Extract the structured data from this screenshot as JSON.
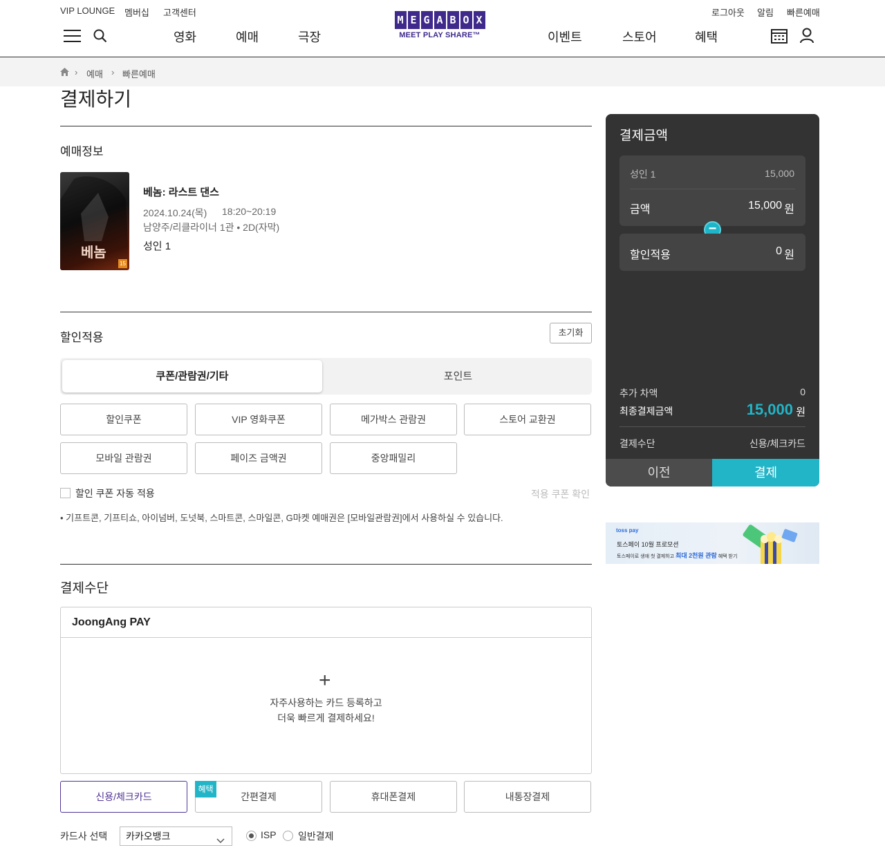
{
  "header": {
    "util_left": [
      "VIP LOUNGE",
      "멤버십",
      "고객센터"
    ],
    "util_right": [
      "로그아웃",
      "알림",
      "빠른예매"
    ],
    "nav_left": [
      "영화",
      "예매",
      "극장"
    ],
    "nav_right": [
      "이벤트",
      "스토어",
      "혜택"
    ],
    "logo_letters": [
      "M",
      "E",
      "G",
      "A",
      "B",
      "O",
      "X"
    ],
    "logo_tagline": "MEET PLAY SHARE™",
    "brand_color": "#3f2a8c"
  },
  "breadcrumb": [
    "예매",
    "빠른예매"
  ],
  "page_title": "결제하기",
  "booking": {
    "section_title": "예매정보",
    "movie_title": "베놈: 라스트 댄스",
    "datetime": "2024.10.24(목)",
    "time": "18:20~20:19",
    "theater": "남양주/리클라이너 1관 • 2D(자막)",
    "people": "성인 1",
    "poster_text": "베놈",
    "rating": "15"
  },
  "discount": {
    "section_title": "할인적용",
    "reset_label": "초기화",
    "tabs": [
      "쿠폰/관람권/기타",
      "포인트"
    ],
    "options": [
      "할인쿠폰",
      "VIP 영화쿠폰",
      "메가박스 관람권",
      "스토어 교환권",
      "모바일 관람권",
      "페이즈 금액권",
      "중앙패밀리"
    ],
    "auto_coupon_label": "할인 쿠폰 자동 적용",
    "check_coupon_label": "적용 쿠폰 확인",
    "note": "• 기프트콘, 기프티쇼, 아이넘버, 도넛북, 스마트콘, 스마일콘, G마켓 예매권은 [모바일관람권]에서 사용하실 수 있습니다."
  },
  "payment": {
    "section_title": "결제수단",
    "pay_brand": "JoongAng PAY",
    "register_line1": "자주사용하는 카드 등록하고",
    "register_line2": "더욱 빠르게 결제하세요!",
    "methods": [
      "신용/체크카드",
      "간편결제",
      "휴대폰결제",
      "내통장결제"
    ],
    "benefit_badge": "혜택",
    "card_select_label": "카드사 선택",
    "card_selected": "카카오뱅크",
    "radio_isp": "ISP",
    "radio_normal": "일반결제"
  },
  "summary": {
    "title": "결제금액",
    "adult_label": "성인 1",
    "adult_price": "15,000",
    "amount_label": "금액",
    "amount_value": "15,000",
    "won": "원",
    "discount_label": "할인적용",
    "discount_value": "0",
    "extra_label": "추가 차액",
    "extra_value": "0",
    "final_label": "최종결제금액",
    "final_value": "15,000",
    "method_label": "결제수단",
    "method_value": "신용/체크카드",
    "prev_label": "이전",
    "pay_label": "결제",
    "accent_color": "#22b5c7"
  },
  "banner": {
    "brand": "toss pay",
    "line1": "토스페이 10월 프로모션",
    "line2_prefix": "토스페이로 생애 첫 결제하고",
    "line2_highlight": "최대 2천원 관람",
    "line2_suffix": "혜택 받기"
  }
}
